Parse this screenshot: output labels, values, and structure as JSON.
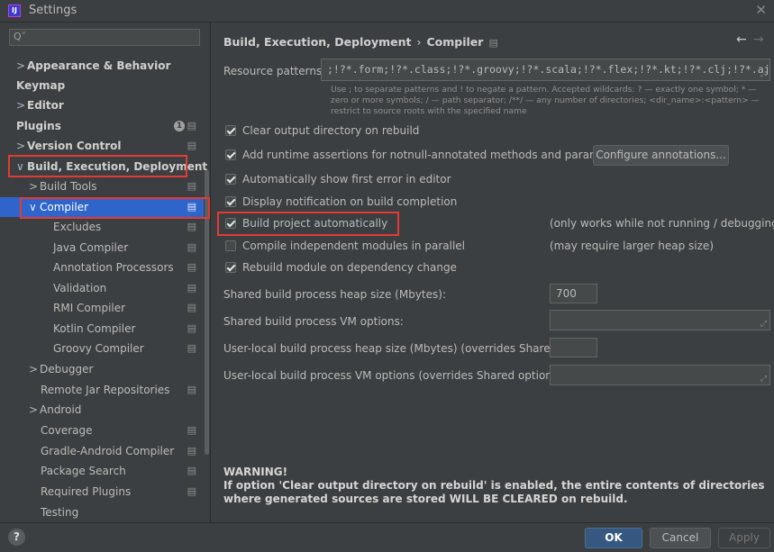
{
  "window": {
    "title": "Settings",
    "app_icon_text": "IJ"
  },
  "search": {
    "glyph": "Qˇ",
    "placeholder": ""
  },
  "sidebar": {
    "items": [
      {
        "label": "Appearance & Behavior",
        "chevron": ">",
        "bold": true
      },
      {
        "label": "Keymap",
        "bold": true
      },
      {
        "label": "Editor",
        "chevron": ">",
        "bold": true
      },
      {
        "label": "Plugins",
        "bold": true,
        "badge": "1"
      },
      {
        "label": "Version Control",
        "chevron": ">",
        "bold": true
      },
      {
        "label": "Build, Execution, Deployment",
        "chevron": "∨",
        "bold": true
      },
      {
        "label": "Build Tools",
        "chevron": ">"
      },
      {
        "label": "Compiler",
        "chevron": "∨",
        "selected": true
      },
      {
        "label": "Excludes"
      },
      {
        "label": "Java Compiler"
      },
      {
        "label": "Annotation Processors"
      },
      {
        "label": "Validation"
      },
      {
        "label": "RMI Compiler"
      },
      {
        "label": "Kotlin Compiler"
      },
      {
        "label": "Groovy Compiler"
      },
      {
        "label": "Debugger",
        "chevron": ">"
      },
      {
        "label": "Remote Jar Repositories"
      },
      {
        "label": "Android",
        "chevron": ">"
      },
      {
        "label": "Coverage"
      },
      {
        "label": "Gradle-Android Compiler"
      },
      {
        "label": "Package Search"
      },
      {
        "label": "Required Plugins"
      },
      {
        "label": "Testing"
      }
    ]
  },
  "breadcrumb": {
    "parent": "Build, Execution, Deployment",
    "separator": "›",
    "current": "Compiler"
  },
  "resource_patterns": {
    "label": "Resource patterns:",
    "value": ";!?*.form;!?*.class;!?*.groovy;!?*.scala;!?*.flex;!?*.kt;!?*.clj;!?*.aj",
    "hint": "Use ; to separate patterns and ! to negate a pattern. Accepted wildcards: ? — exactly one symbol; * — zero or more symbols; / — path separator; /**/ — any number of directories; <dir_name>:<pattern> — restrict to source roots with the specified name"
  },
  "options": {
    "clear_output": {
      "label": "Clear output directory on rebuild",
      "checked": true
    },
    "runtime_assertions": {
      "label": "Add runtime assertions for notnull-annotated methods and parameters",
      "checked": true
    },
    "show_first_error": {
      "label": "Automatically show first error in editor",
      "checked": true
    },
    "notify_completion": {
      "label": "Display notification on build completion",
      "checked": true
    },
    "build_auto": {
      "label": "Build project automatically",
      "checked": true,
      "note": "(only works while not running / debugging)"
    },
    "parallel": {
      "label": "Compile independent modules in parallel",
      "checked": false,
      "note": "(may require larger heap size)"
    },
    "rebuild_dep": {
      "label": "Rebuild module on dependency change",
      "checked": true
    }
  },
  "configure_annotations": "Configure annotations...",
  "fields": {
    "shared_heap": {
      "label": "Shared build process heap size (Mbytes):",
      "value": "700"
    },
    "shared_vm": {
      "label": "Shared build process VM options:",
      "value": ""
    },
    "local_heap": {
      "label": "User-local build process heap size (Mbytes) (overrides Shared size):",
      "value": ""
    },
    "local_vm": {
      "label": "User-local build process VM options (overrides Shared options):",
      "value": ""
    }
  },
  "warning": {
    "title": "WARNING!",
    "text": "If option 'Clear output directory on rebuild' is enabled, the entire contents of directories where generated sources are stored WILL BE CLEARED on rebuild."
  },
  "footer": {
    "help": "?",
    "ok": "OK",
    "cancel": "Cancel",
    "apply": "Apply"
  },
  "colors": {
    "accent": "#2f65ca",
    "highlight_border": "#e53935",
    "background": "#3c3f41"
  }
}
